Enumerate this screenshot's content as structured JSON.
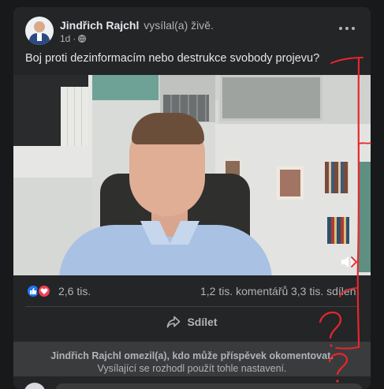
{
  "post": {
    "author": "Jindřich Rajchl",
    "action": "vysílal(a) živě.",
    "time": "1d",
    "privacy_icon": "globe-icon",
    "text": "Boj proti dezinformacím nebo destrukce svobody projevu?"
  },
  "stats": {
    "reaction_icons": [
      "like-icon",
      "heart-icon"
    ],
    "reactions": "2,6 tis.",
    "comments": "1,2 tis. komentářů",
    "shares": "3,3 tis. sdílen"
  },
  "actions": {
    "share_label": "Sdílet"
  },
  "notice": {
    "title": "Jindřich Rajchl omezil(a), kdo může příspěvek okomentovat.",
    "subtitle": "Vysílající se rozhodl použít tohle nastavení."
  },
  "colors": {
    "background": "#18191a",
    "card": "#242526",
    "like": "#2078f4",
    "love": "#f33e58",
    "annotation": "#e8262d"
  }
}
